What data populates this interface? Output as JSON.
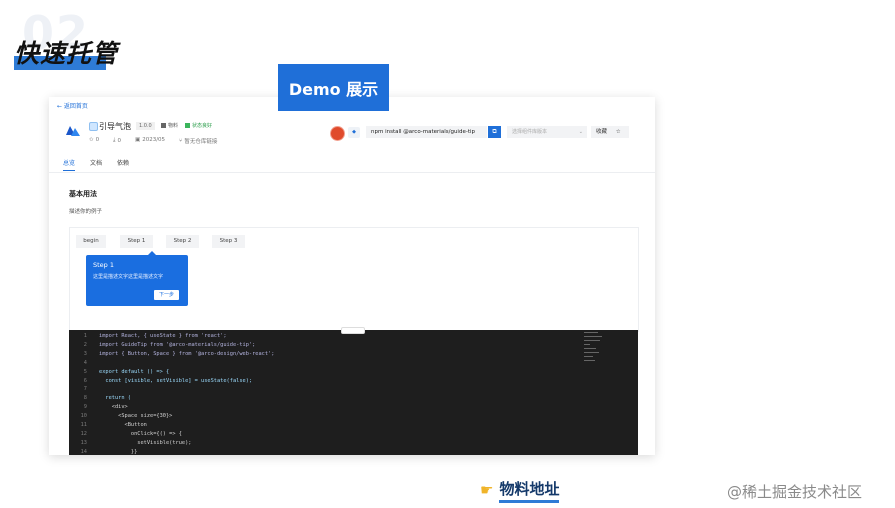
{
  "slide": {
    "number_bg": "02",
    "title": "快速托管",
    "demo_badge": "Demo 展示",
    "link_text": "物料地址",
    "watermark": "@稀土掘金技术社区"
  },
  "app": {
    "back_link": "← 返回首页",
    "component_name": "引导气泡",
    "version": "1.0.0",
    "tag_business": "物料",
    "tag_status": "状态良好",
    "meta": {
      "stars": "0",
      "downloads": "0",
      "date": "2023/05",
      "link": "暂无仓库链接"
    },
    "npm_command": "npm install @arco-materials/guide-tip",
    "select_placeholder": "选择组件库版本",
    "collect_label": "收藏",
    "tabs": [
      "总览",
      "文档",
      "依赖"
    ],
    "section_title": "基本用法",
    "section_desc": "描述你的例子",
    "steps": [
      "begin",
      "Step 1",
      "Step 2",
      "Step 3"
    ],
    "tooltip": {
      "title": "Step 1",
      "text": "这里是描述文字这里是描述文字",
      "next_button": "下一步"
    }
  },
  "code": {
    "line_numbers": [
      "1",
      "2",
      "3",
      "4",
      "5",
      "6",
      "7",
      "8",
      "9",
      "10",
      "11",
      "12",
      "13",
      "14"
    ],
    "lines": [
      "import React, { useState } from 'react';",
      "import GuideTip from '@arco-materials/guide-tip';",
      "import { Button, Space } from '@arco-design/web-react';",
      "",
      "export default () => {",
      "  const [visible, setVisible] = useState(false);",
      "",
      "  return (",
      "    <div>",
      "      <Space size={30}>",
      "        <Button",
      "          onClick={() => {",
      "            setVisible(true);",
      "          }}"
    ]
  },
  "colors": {
    "accent": "#1f6fd8",
    "code_bg": "#1e1e1e",
    "title_bar": "#2e7bd6"
  },
  "icons": {
    "logo": "arco-logo-icon",
    "hand": "pointing-hand-icon"
  }
}
